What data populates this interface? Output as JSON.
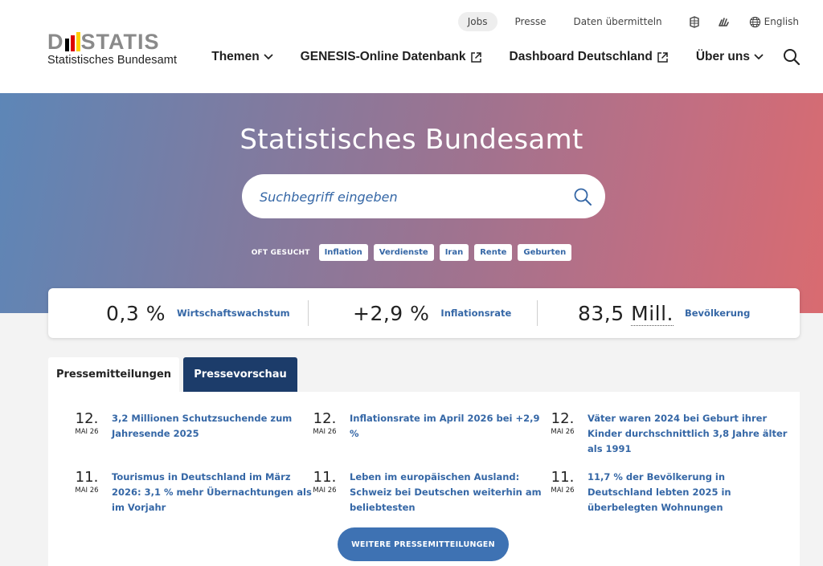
{
  "header": {
    "logo_word_left": "D",
    "logo_word_right": "STATIS",
    "logo_sub": "Statistisches Bundesamt",
    "meta": {
      "jobs": "Jobs",
      "presse": "Presse",
      "daten": "Daten übermitteln",
      "language": "English"
    },
    "nav": {
      "themen": "Themen",
      "genesis": "GENESIS-Online Datenbank",
      "dashboard": "Dashboard Deutschland",
      "ueber": "Über uns"
    }
  },
  "hero": {
    "title": "Statistisches Bundesamt",
    "search_placeholder": "Suchbegriff eingeben",
    "often_label": "OFT GESUCHT",
    "chips": [
      "Inflation",
      "Verdienste",
      "Iran",
      "Rente",
      "Geburten"
    ]
  },
  "stats": [
    {
      "value": "0,3 %",
      "label": "Wirtschaftswachstum"
    },
    {
      "value": "+2,9 %",
      "label": "Inflationsrate"
    },
    {
      "value_num": "83,5",
      "value_unit": "Mill.",
      "label": "Bevölkerung"
    }
  ],
  "tabs": {
    "press": "Pressemitteilungen",
    "preview": "Pressevorschau"
  },
  "news": [
    {
      "day": "12.",
      "month": "MAI 26",
      "title": "3,2 Millionen Schutzsuchende zum Jahresende 2025"
    },
    {
      "day": "12.",
      "month": "MAI 26",
      "title": "Inflationsrate im April 2026 bei +2,9 %"
    },
    {
      "day": "12.",
      "month": "MAI 26",
      "title": "Väter waren 2024 bei Geburt ihrer Kinder durchschnittlich 3,8 Jahre älter als 1991"
    },
    {
      "day": "11.",
      "month": "MAI 26",
      "title": "Tourismus in Deutschland im März 2026: 3,1 % mehr Übernachtungen als im Vorjahr"
    },
    {
      "day": "11.",
      "month": "MAI 26",
      "title": "Leben im europäischen Ausland: Schweiz bei Deutschen weiterhin am beliebtesten"
    },
    {
      "day": "11.",
      "month": "MAI 26",
      "title": "11,7 % der Bevölkerung in Deutschland lebten 2025 in überbelegten Wohnungen"
    }
  ],
  "more_button": "WEITERE PRESSEMITTEILUNGEN",
  "colors": {
    "link": "#3567a6",
    "navy": "#1c3c6a",
    "button": "#3e72b3",
    "flag_black": "#000000",
    "flag_red": "#dd0000",
    "flag_gold": "#ffce00"
  }
}
